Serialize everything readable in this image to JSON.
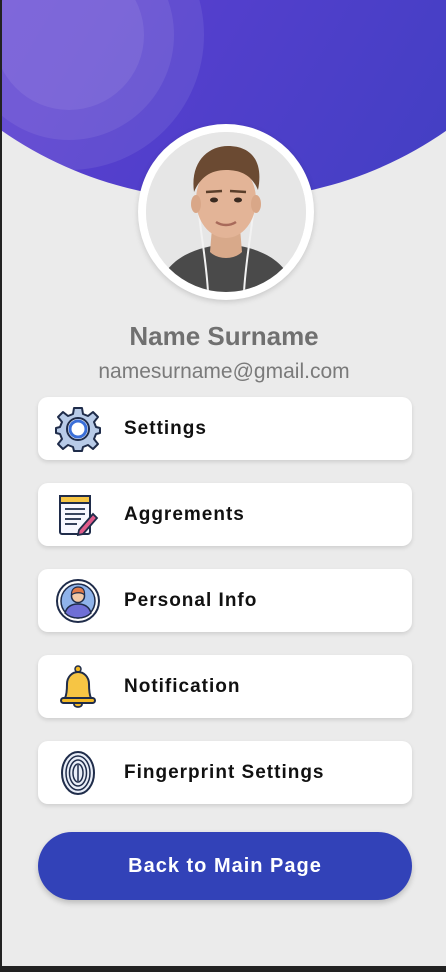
{
  "profile": {
    "name": "Name Surname",
    "email": "namesurname@gmail.com",
    "avatar_icon": "user-photo"
  },
  "menu": {
    "items": [
      {
        "label": "Settings",
        "icon": "gear-icon"
      },
      {
        "label": "Aggrements",
        "icon": "document-pencil-icon"
      },
      {
        "label": "Personal Info",
        "icon": "person-icon"
      },
      {
        "label": "Notification",
        "icon": "bell-icon"
      },
      {
        "label": "Fingerprint Settings",
        "icon": "fingerprint-icon"
      }
    ]
  },
  "actions": {
    "back_label": "Back to Main Page"
  },
  "colors": {
    "header_gradient_start": "#7a3fd6",
    "header_gradient_end": "#3b3fbf",
    "button": "#3242b8",
    "background": "#ebebeb"
  }
}
